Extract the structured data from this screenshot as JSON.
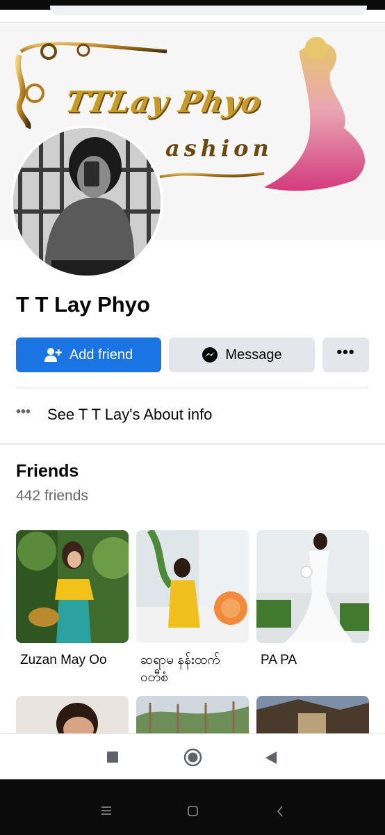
{
  "profile": {
    "name": "T T Lay Phyo",
    "cover_title": "TTLay Phyo",
    "cover_subtitle": "ashion"
  },
  "actions": {
    "add_friend": "Add friend",
    "message": "Message",
    "more": "•••"
  },
  "about": {
    "text": "See T T Lay's About info",
    "icon": "more-horizontal-icon"
  },
  "friends": {
    "title": "Friends",
    "count_text": "442 friends",
    "items": [
      {
        "name": "Zuzan May Oo"
      },
      {
        "name": "ဆရာမ နန်းထက်\nဝတီစံ"
      },
      {
        "name": "PA PA"
      }
    ]
  },
  "colors": {
    "primary": "#1b74e4",
    "secondary_button": "#e4e6eb",
    "secondary_text": "#65676b",
    "text": "#050505"
  },
  "nav": {
    "icons": [
      "square-stop-icon",
      "circle-home-icon",
      "triangle-back-icon"
    ]
  },
  "system_nav": {
    "icons": [
      "menu-lines-icon",
      "square-icon",
      "chevron-left-icon"
    ]
  }
}
